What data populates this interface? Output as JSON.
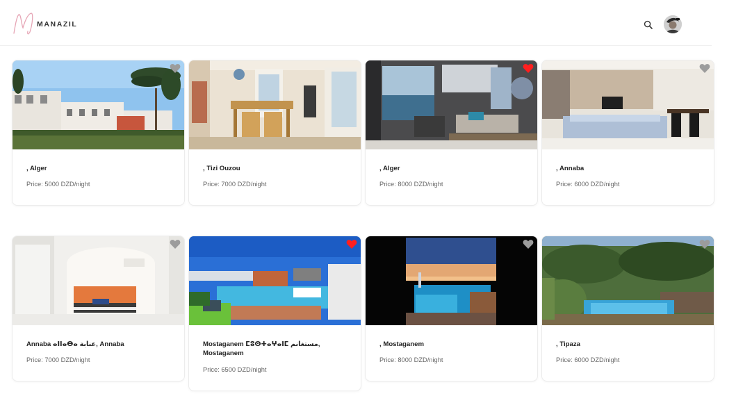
{
  "header": {
    "brand": "MANAZIL",
    "logo_icon": "script-m-logo-icon",
    "search_icon": "search-icon",
    "avatar_icon": "user-avatar"
  },
  "favorite_color_active": "#ff1f1f",
  "favorite_color_inactive": "#9c9c9c",
  "listings": [
    {
      "title": ", Alger",
      "price": "Price: 5000 DZD/night",
      "favorite": false
    },
    {
      "title": ", Tizi Ouzou",
      "price": "Price: 7000 DZD/night",
      "favorite": false
    },
    {
      "title": ", Alger",
      "price": "Price: 8000 DZD/night",
      "favorite": true
    },
    {
      "title": ", Annaba",
      "price": "Price: 6000 DZD/night",
      "favorite": false
    },
    {
      "title": "Annaba ⴰⵏⵏⴰⴱⴰ عنابة, Annaba",
      "price": "Price: 7000 DZD/night",
      "favorite": false
    },
    {
      "title": "Mostaganem ⵎⵓⵙⵜⴰⵖⴰⵏⵎ مستغانم, Mostaganem",
      "price": "Price: 6500 DZD/night",
      "favorite": true
    },
    {
      "title": ", Mostaganem",
      "price": "Price: 8000 DZD/night",
      "favorite": false
    },
    {
      "title": ", Tipaza",
      "price": "Price: 6000 DZD/night",
      "favorite": false
    }
  ]
}
